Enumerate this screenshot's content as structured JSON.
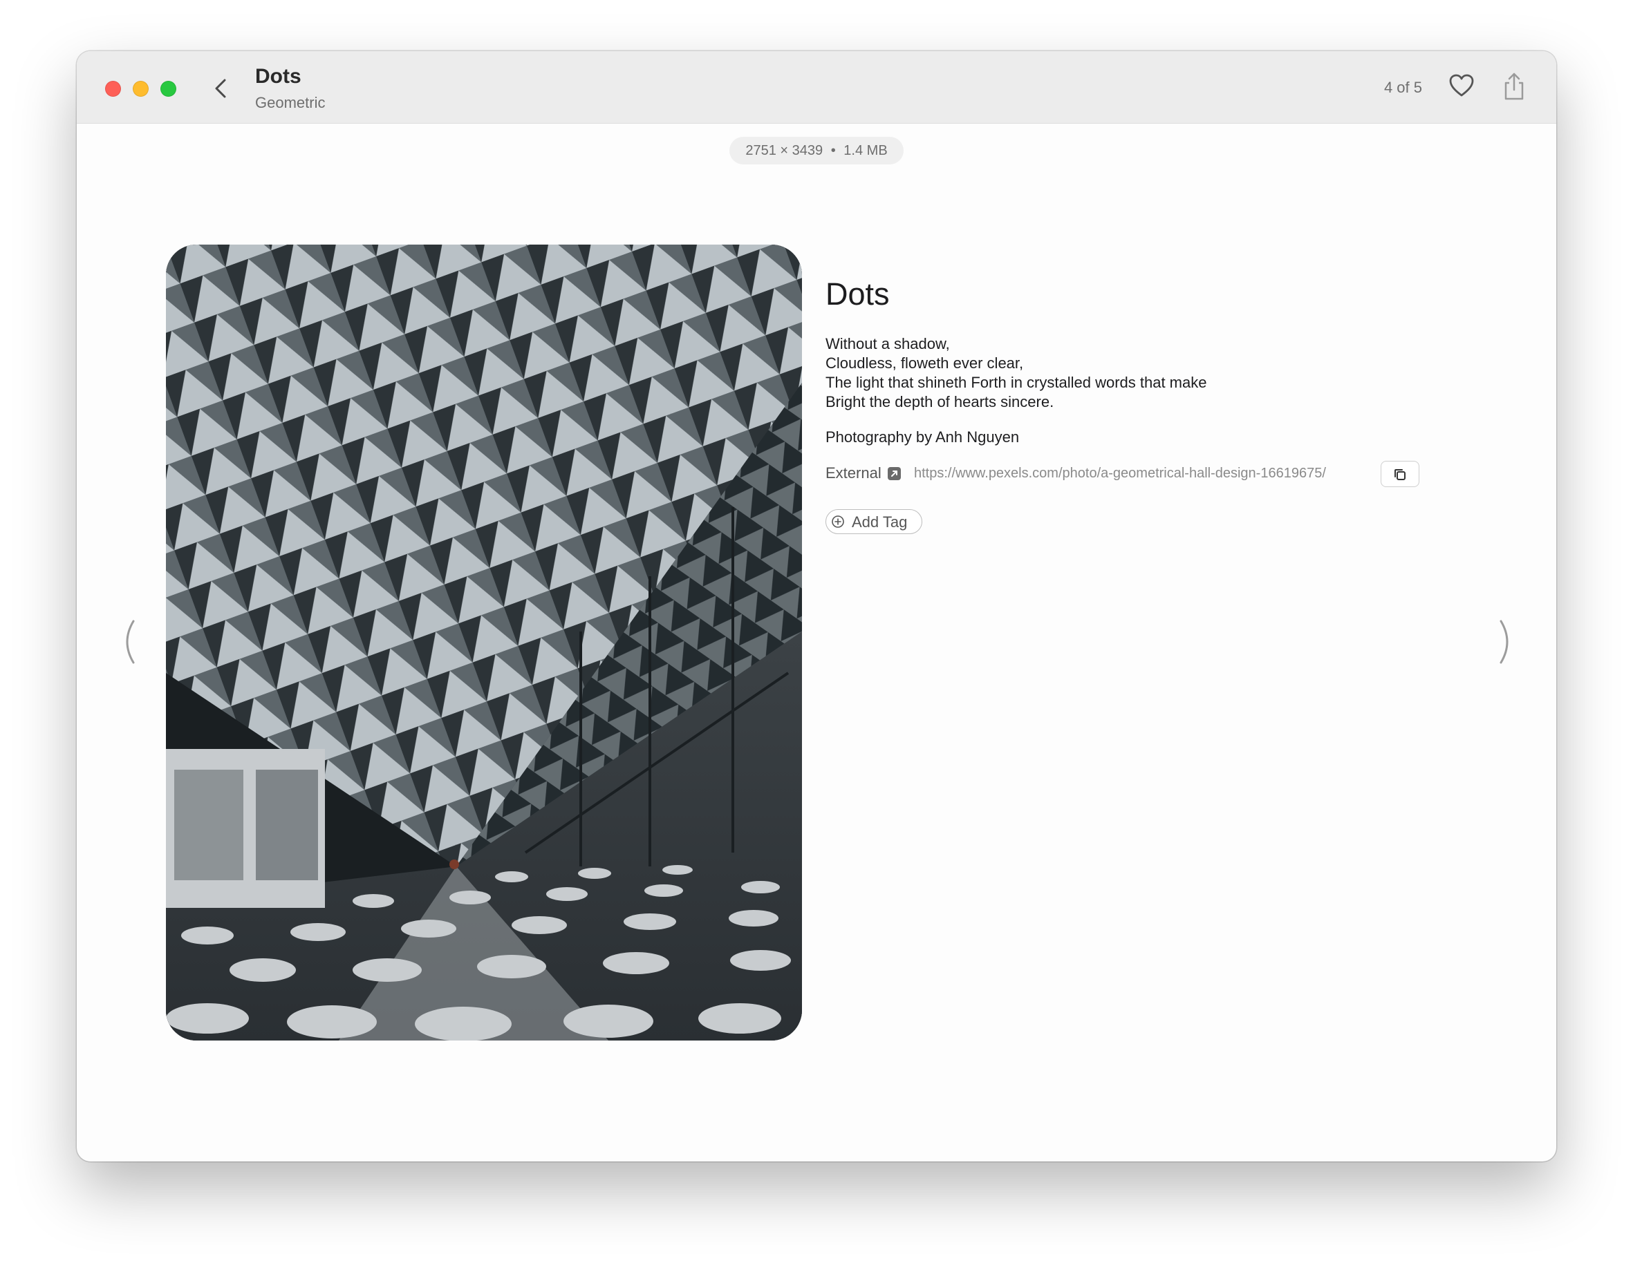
{
  "window": {
    "title": "Dots",
    "subtitle": "Geometric",
    "counter": "4 of 5"
  },
  "image_meta": {
    "width": "2751",
    "times": "×",
    "height": "3439",
    "separator": "•",
    "size": "1.4 MB"
  },
  "details": {
    "title": "Dots",
    "description_lines": [
      "Without a shadow,",
      "Cloudless, floweth ever clear,",
      "The light that shineth Forth in crystalled words that make",
      "Bright the depth of hearts sincere."
    ],
    "credit": "Photography by Anh Nguyen",
    "external_label": "External",
    "external_url": "https://www.pexels.com/photo/a-geometrical-hall-design-16619675/",
    "add_tag_label": "Add Tag"
  },
  "icons": {
    "back": "chevron-left-icon",
    "favorite": "heart-icon",
    "share": "share-icon",
    "external": "external-link-icon",
    "copy": "copy-icon",
    "add": "plus-circle-icon",
    "prev": "chevron-left-icon",
    "next": "chevron-right-icon"
  },
  "colors": {
    "close": "#fe5f57",
    "minimize": "#febc2e",
    "zoom": "#28c840",
    "titlebar": "#ececec"
  }
}
